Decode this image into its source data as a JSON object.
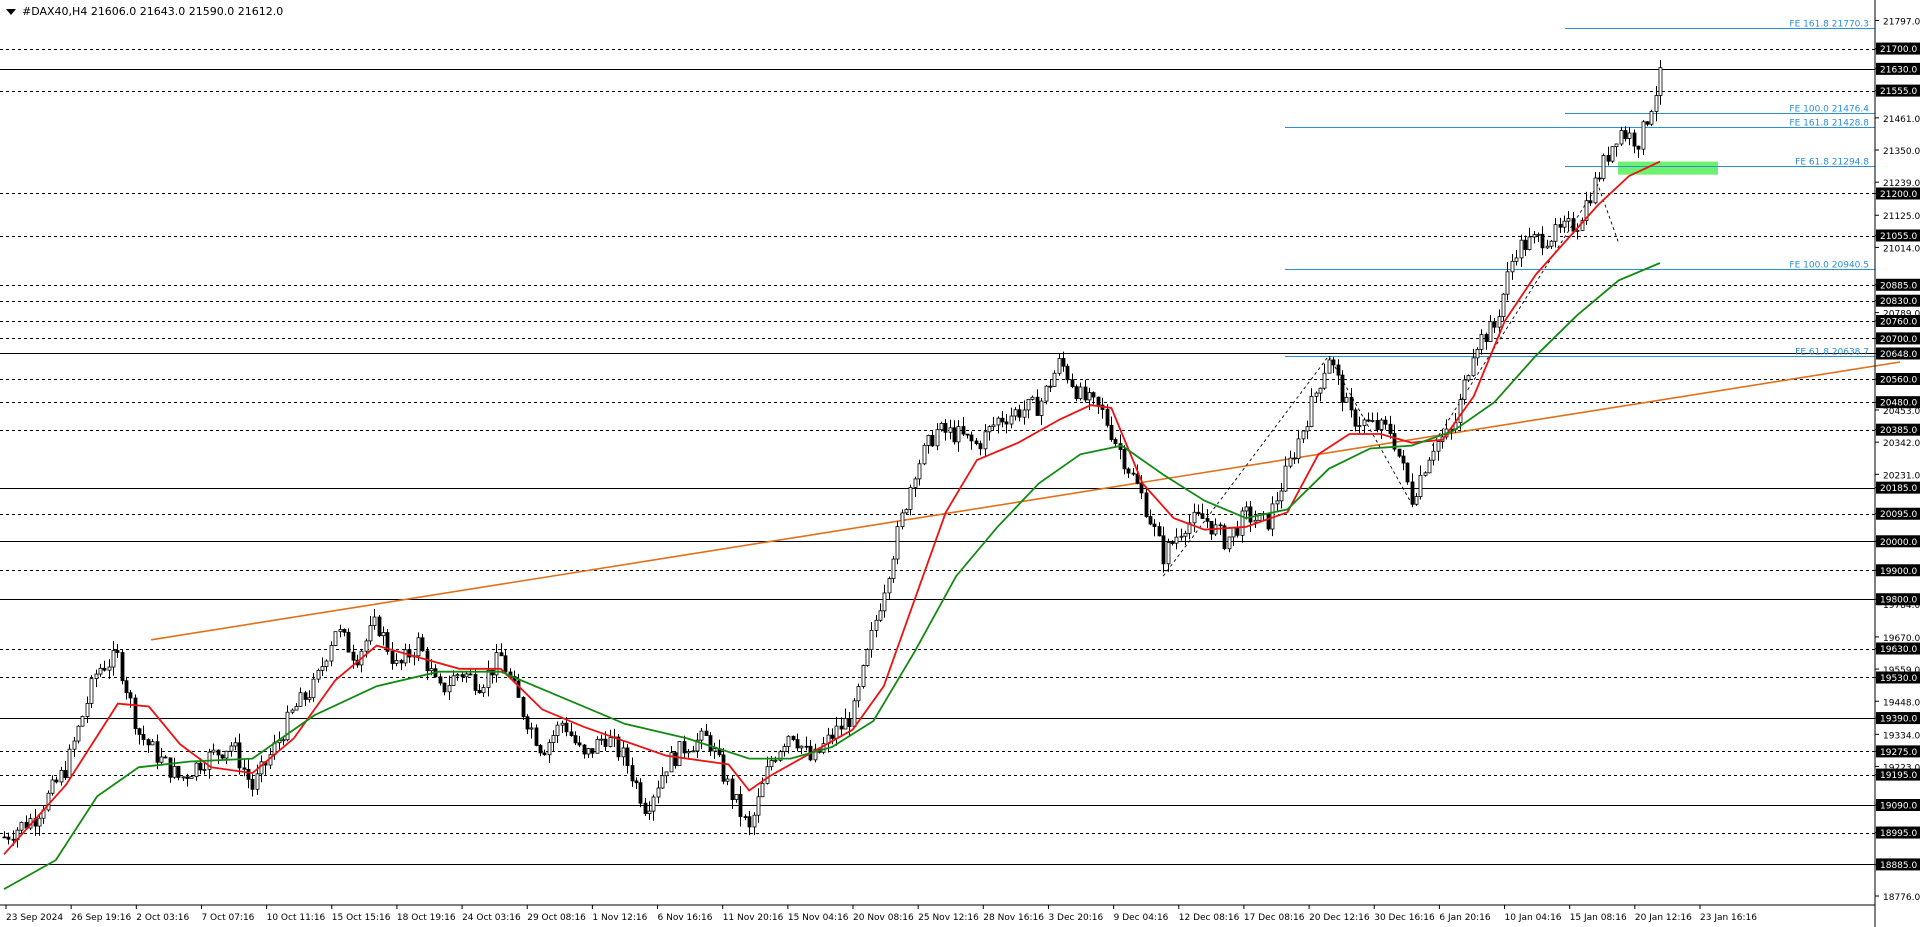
{
  "header": {
    "title": "#DAX40,H4  21606.0 21643.0 21590.0 21612.0"
  },
  "colors": {
    "background": "#ffffff",
    "grid": "#000000",
    "bull_candle": "#000000",
    "bear_candle": "#000000",
    "ma_fast": "#ee1111",
    "ma_slow": "#128a12",
    "trendline": "#e0701a",
    "fib": "#2b8fd8",
    "zone": "#55ee55",
    "current_price_bg": "#000000"
  },
  "chart_data": {
    "type": "candlestick",
    "symbol": "#DAX40",
    "timeframe": "H4",
    "ohlc_last": {
      "open": 21606.0,
      "high": 21643.0,
      "low": 21590.0,
      "close": 21612.0
    },
    "ylim": [
      18745,
      21840
    ],
    "x_ticks": [
      "23 Sep 2024",
      "26 Sep 19:16",
      "2 Oct 03:16",
      "7 Oct 07:16",
      "10 Oct 11:16",
      "15 Oct 15:16",
      "18 Oct 19:16",
      "24 Oct 03:16",
      "29 Oct 08:16",
      "1 Nov 12:16",
      "6 Nov 16:16",
      "11 Nov 20:16",
      "15 Nov 04:16",
      "20 Nov 08:16",
      "25 Nov 12:16",
      "28 Nov 16:16",
      "3 Dec 20:16",
      "9 Dec 04:16",
      "12 Dec 08:16",
      "17 Dec 08:16",
      "20 Dec 12:16",
      "30 Dec 16:16",
      "6 Jan 20:16",
      "10 Jan 04:16",
      "15 Jan 08:16",
      "20 Jan 12:16",
      "23 Jan 16:16"
    ],
    "y_ticks": [
      21797.0,
      21700.0,
      21630.0,
      21555.0,
      21461.0,
      21350.0,
      21239.0,
      21200.0,
      21125.0,
      21055.0,
      21014.0,
      20885.0,
      20830.0,
      20789.0,
      20760.0,
      20700.0,
      20648.0,
      20560.0,
      20480.0,
      20453.0,
      20385.0,
      20342.0,
      20231.0,
      20185.0,
      20095.0,
      20000.0,
      19900.0,
      19800.0,
      19784.0,
      19670.0,
      19630.0,
      19559.0,
      19530.0,
      19448.0,
      19390.0,
      19334.0,
      19275.0,
      19223.0,
      19195.0,
      19090.0,
      18995.0,
      18885.0,
      18776.0
    ],
    "levels": [
      {
        "price": 21700.0,
        "style": "dashed"
      },
      {
        "price": 21630.0,
        "style": "solid"
      },
      {
        "price": 21555.0,
        "style": "dashed"
      },
      {
        "price": 21200.0,
        "style": "dashed"
      },
      {
        "price": 21055.0,
        "style": "dashed"
      },
      {
        "price": 20885.0,
        "style": "dashed"
      },
      {
        "price": 20830.0,
        "style": "dashed"
      },
      {
        "price": 20760.0,
        "style": "dashed"
      },
      {
        "price": 20700.0,
        "style": "dashed"
      },
      {
        "price": 20648.0,
        "style": "solid"
      },
      {
        "price": 20560.0,
        "style": "dashed"
      },
      {
        "price": 20480.0,
        "style": "dashed"
      },
      {
        "price": 20385.0,
        "style": "dashed"
      },
      {
        "price": 20185.0,
        "style": "solid"
      },
      {
        "price": 20095.0,
        "style": "dashed"
      },
      {
        "price": 20000.0,
        "style": "solid"
      },
      {
        "price": 19900.0,
        "style": "dashed"
      },
      {
        "price": 19800.0,
        "style": "solid"
      },
      {
        "price": 19630.0,
        "style": "dashed"
      },
      {
        "price": 19530.0,
        "style": "dashed"
      },
      {
        "price": 19390.0,
        "style": "solid"
      },
      {
        "price": 19275.0,
        "style": "dashed"
      },
      {
        "price": 19195.0,
        "style": "dashed"
      },
      {
        "price": 19090.0,
        "style": "solid"
      },
      {
        "price": 18995.0,
        "style": "dashed"
      },
      {
        "price": 18885.0,
        "style": "solid"
      }
    ],
    "fib_levels": [
      {
        "label": "FE 161.8 21770.3",
        "price": 21770.3,
        "x_start": "20 Jan 12:16"
      },
      {
        "label": "FE 100.0 21476.4",
        "price": 21476.4,
        "x_start": "20 Jan 12:16"
      },
      {
        "label": "FE 161.8 21428.8",
        "price": 21428.8,
        "x_start": "20 Dec 12:16"
      },
      {
        "label": "FE 61.8 21294.8",
        "price": 21294.8,
        "x_start": "20 Jan 12:16"
      },
      {
        "label": "FE 100.0 20940.5",
        "price": 20940.5,
        "x_start": "20 Dec 12:16"
      },
      {
        "label": "FE 61.8 20638.7",
        "price": 20638.7,
        "x_start": "20 Dec 12:16"
      }
    ],
    "zone": {
      "price_low": 21265,
      "price_high": 21310
    },
    "trendline": {
      "start": {
        "x": "26 Sep 19:16",
        "price": 19660
      },
      "end": {
        "x": "23 Jan 16:16",
        "price": 20660
      }
    },
    "current_price": 21612.0,
    "series": [
      {
        "type": "candles",
        "points": [
          [
            0,
            18980
          ],
          [
            3,
            19050
          ],
          [
            6,
            19220
          ],
          [
            9,
            19560
          ],
          [
            11,
            19600
          ],
          [
            13,
            19340
          ],
          [
            15,
            19250
          ],
          [
            17,
            19180
          ],
          [
            19,
            19240
          ],
          [
            22,
            19300
          ],
          [
            24,
            19150
          ],
          [
            26,
            19280
          ],
          [
            28,
            19420
          ],
          [
            30,
            19500
          ],
          [
            32,
            19700
          ],
          [
            34,
            19600
          ],
          [
            36,
            19720
          ],
          [
            38,
            19560
          ],
          [
            40,
            19650
          ],
          [
            42,
            19480
          ],
          [
            44,
            19550
          ],
          [
            46,
            19510
          ],
          [
            48,
            19600
          ],
          [
            50,
            19420
          ],
          [
            52,
            19280
          ],
          [
            54,
            19380
          ],
          [
            56,
            19250
          ],
          [
            58,
            19330
          ],
          [
            60,
            19250
          ],
          [
            62,
            19080
          ],
          [
            64,
            19230
          ],
          [
            66,
            19300
          ],
          [
            68,
            19320
          ],
          [
            70,
            19150
          ],
          [
            72,
            19000
          ],
          [
            74,
            19240
          ],
          [
            76,
            19350
          ],
          [
            78,
            19240
          ],
          [
            80,
            19330
          ],
          [
            82,
            19400
          ],
          [
            84,
            19700
          ],
          [
            86,
            19980
          ],
          [
            88,
            20250
          ],
          [
            90,
            20380
          ],
          [
            92,
            20370
          ],
          [
            94,
            20330
          ],
          [
            96,
            20420
          ],
          [
            98,
            20450
          ],
          [
            100,
            20470
          ],
          [
            102,
            20620
          ],
          [
            104,
            20500
          ],
          [
            106,
            20450
          ],
          [
            108,
            20300
          ],
          [
            110,
            20150
          ],
          [
            112,
            19950
          ],
          [
            114,
            20060
          ],
          [
            116,
            20080
          ],
          [
            118,
            20000
          ],
          [
            120,
            20090
          ],
          [
            122,
            20060
          ],
          [
            124,
            20250
          ],
          [
            126,
            20440
          ],
          [
            128,
            20640
          ],
          [
            130,
            20430
          ],
          [
            132,
            20400
          ],
          [
            134,
            20380
          ],
          [
            136,
            20150
          ],
          [
            138,
            20330
          ],
          [
            140,
            20380
          ],
          [
            142,
            20680
          ],
          [
            144,
            20740
          ],
          [
            146,
            21010
          ],
          [
            148,
            21040
          ],
          [
            150,
            21060
          ],
          [
            152,
            21100
          ],
          [
            154,
            21260
          ],
          [
            156,
            21420
          ],
          [
            158,
            21380
          ],
          [
            160,
            21600
          ]
        ]
      },
      {
        "name": "",
        "type": "ma_fast",
        "points": [
          [
            0,
            18920
          ],
          [
            6,
            19160
          ],
          [
            11,
            19440
          ],
          [
            14,
            19430
          ],
          [
            17,
            19300
          ],
          [
            20,
            19220
          ],
          [
            24,
            19200
          ],
          [
            28,
            19320
          ],
          [
            32,
            19520
          ],
          [
            36,
            19640
          ],
          [
            40,
            19600
          ],
          [
            44,
            19560
          ],
          [
            48,
            19560
          ],
          [
            52,
            19420
          ],
          [
            56,
            19360
          ],
          [
            60,
            19310
          ],
          [
            64,
            19260
          ],
          [
            68,
            19240
          ],
          [
            70,
            19230
          ],
          [
            72,
            19140
          ],
          [
            74,
            19190
          ],
          [
            78,
            19270
          ],
          [
            82,
            19350
          ],
          [
            85,
            19500
          ],
          [
            88,
            19800
          ],
          [
            91,
            20100
          ],
          [
            94,
            20280
          ],
          [
            98,
            20340
          ],
          [
            102,
            20420
          ],
          [
            105,
            20470
          ],
          [
            107,
            20460
          ],
          [
            110,
            20200
          ],
          [
            113,
            20080
          ],
          [
            116,
            20040
          ],
          [
            120,
            20050
          ],
          [
            124,
            20100
          ],
          [
            127,
            20300
          ],
          [
            130,
            20370
          ],
          [
            133,
            20370
          ],
          [
            136,
            20340
          ],
          [
            139,
            20350
          ],
          [
            142,
            20500
          ],
          [
            145,
            20760
          ],
          [
            148,
            20920
          ],
          [
            151,
            21040
          ],
          [
            154,
            21160
          ],
          [
            157,
            21260
          ],
          [
            160,
            21310
          ]
        ]
      },
      {
        "name": "",
        "type": "ma_slow",
        "points": [
          [
            0,
            18800
          ],
          [
            5,
            18900
          ],
          [
            9,
            19120
          ],
          [
            13,
            19220
          ],
          [
            18,
            19240
          ],
          [
            24,
            19250
          ],
          [
            30,
            19400
          ],
          [
            36,
            19500
          ],
          [
            42,
            19550
          ],
          [
            48,
            19550
          ],
          [
            54,
            19460
          ],
          [
            60,
            19370
          ],
          [
            66,
            19320
          ],
          [
            72,
            19250
          ],
          [
            76,
            19250
          ],
          [
            80,
            19290
          ],
          [
            84,
            19380
          ],
          [
            88,
            19620
          ],
          [
            92,
            19880
          ],
          [
            96,
            20050
          ],
          [
            100,
            20200
          ],
          [
            104,
            20300
          ],
          [
            108,
            20330
          ],
          [
            112,
            20230
          ],
          [
            116,
            20140
          ],
          [
            120,
            20080
          ],
          [
            124,
            20110
          ],
          [
            128,
            20250
          ],
          [
            132,
            20320
          ],
          [
            136,
            20330
          ],
          [
            140,
            20380
          ],
          [
            144,
            20480
          ],
          [
            148,
            20640
          ],
          [
            152,
            20780
          ],
          [
            156,
            20900
          ],
          [
            160,
            20960
          ]
        ]
      }
    ],
    "zigzags": [
      [
        [
          112,
          19880
        ],
        [
          128,
          20640
        ],
        [
          136,
          20130
        ]
      ],
      [
        [
          138,
          20330
        ],
        [
          154,
          21230
        ],
        [
          156,
          21030
        ]
      ]
    ]
  }
}
